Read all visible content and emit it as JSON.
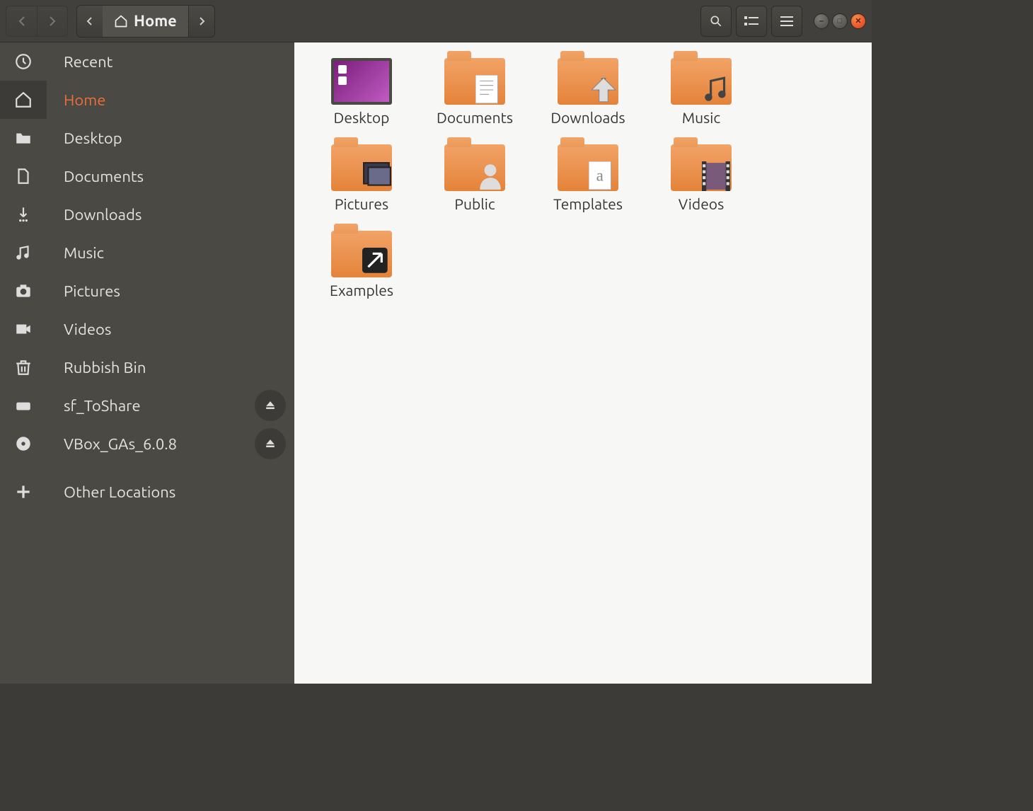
{
  "toolbar": {
    "path_segment": "Home"
  },
  "sidebar": {
    "items": [
      {
        "label": "Recent",
        "icon": "clock"
      },
      {
        "label": "Home",
        "icon": "home",
        "active": true
      },
      {
        "label": "Desktop",
        "icon": "folder"
      },
      {
        "label": "Documents",
        "icon": "document"
      },
      {
        "label": "Downloads",
        "icon": "download"
      },
      {
        "label": "Music",
        "icon": "music"
      },
      {
        "label": "Pictures",
        "icon": "camera"
      },
      {
        "label": "Videos",
        "icon": "video"
      },
      {
        "label": "Rubbish Bin",
        "icon": "trash"
      },
      {
        "label": "sf_ToShare",
        "icon": "drive",
        "eject": true
      },
      {
        "label": "VBox_GAs_6.0.8",
        "icon": "disc",
        "eject": true
      },
      {
        "label": "Other Locations",
        "icon": "plus",
        "other": true
      }
    ]
  },
  "main": {
    "items": [
      {
        "label": "Desktop",
        "kind": "desktop"
      },
      {
        "label": "Documents",
        "kind": "folder",
        "overlay": "document"
      },
      {
        "label": "Downloads",
        "kind": "folder",
        "overlay": "download"
      },
      {
        "label": "Music",
        "kind": "folder",
        "overlay": "music"
      },
      {
        "label": "Pictures",
        "kind": "folder",
        "overlay": "pictures"
      },
      {
        "label": "Public",
        "kind": "folder",
        "overlay": "public"
      },
      {
        "label": "Templates",
        "kind": "folder",
        "overlay": "template"
      },
      {
        "label": "Videos",
        "kind": "folder",
        "overlay": "video"
      },
      {
        "label": "Examples",
        "kind": "folder",
        "overlay": "link"
      }
    ]
  },
  "colors": {
    "accent": "#e96f3c",
    "folder": "#e4833a"
  }
}
